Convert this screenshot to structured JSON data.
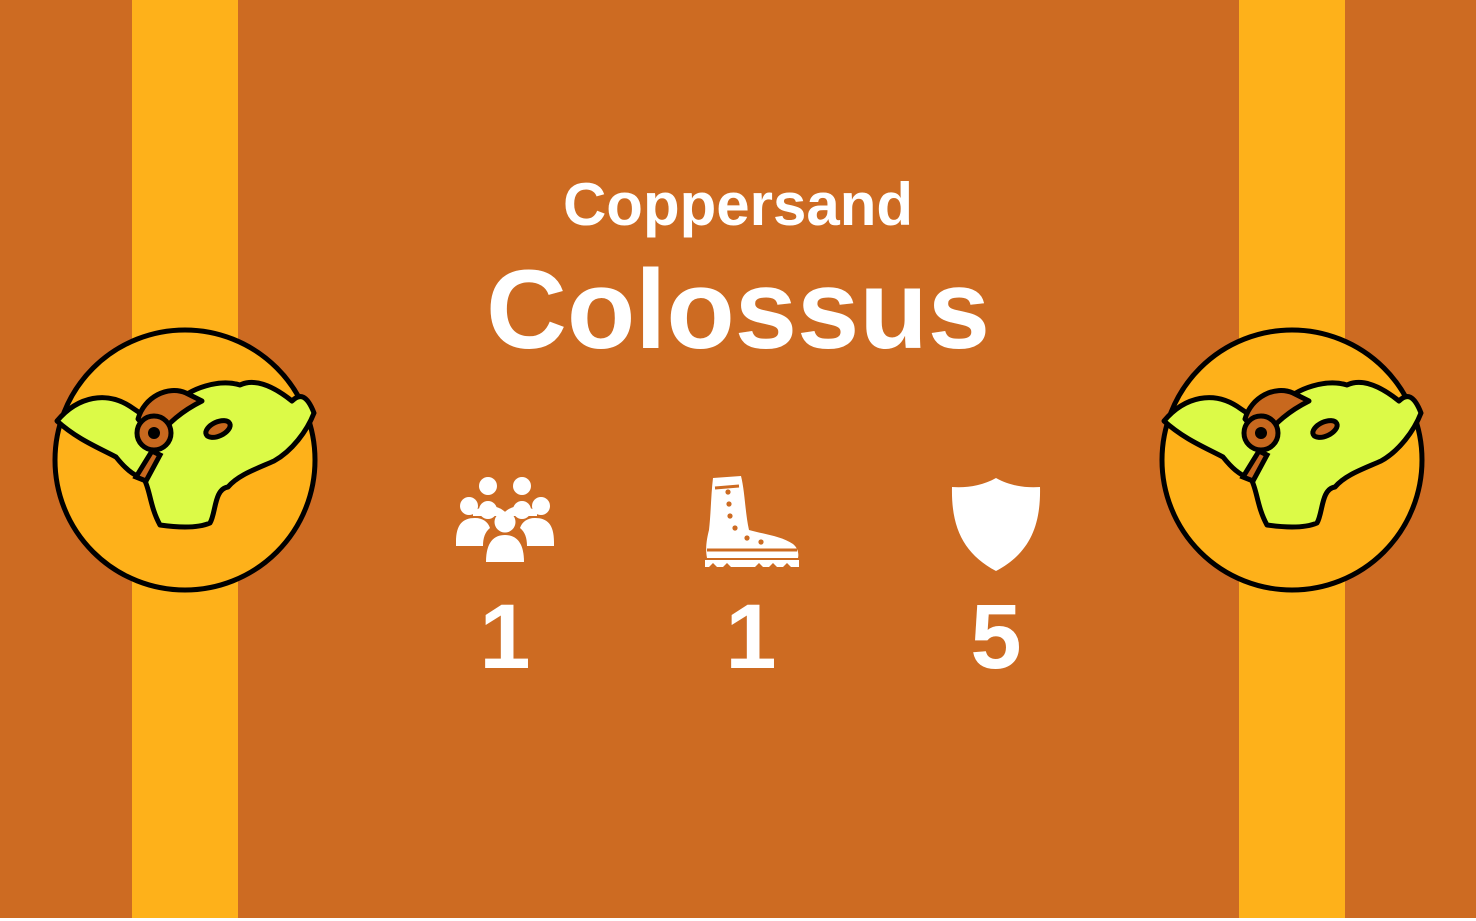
{
  "card": {
    "subtitle": "Coppersand",
    "title": "Colossus",
    "colors": {
      "background": "#cd6b22",
      "stripe": "#feb11a",
      "emblem_fill": "#feb11a",
      "emblem_outline": "#000000",
      "creature": "#dcfa47",
      "creature_accent": "#c8681e",
      "text": "#ffffff"
    },
    "emblem_icon": "gear-beast-emblem-icon"
  },
  "stats": {
    "population": {
      "icon": "people-group-icon",
      "value": "1"
    },
    "movement": {
      "icon": "boot-icon",
      "value": "1"
    },
    "defense": {
      "icon": "shield-icon",
      "value": "5"
    }
  }
}
